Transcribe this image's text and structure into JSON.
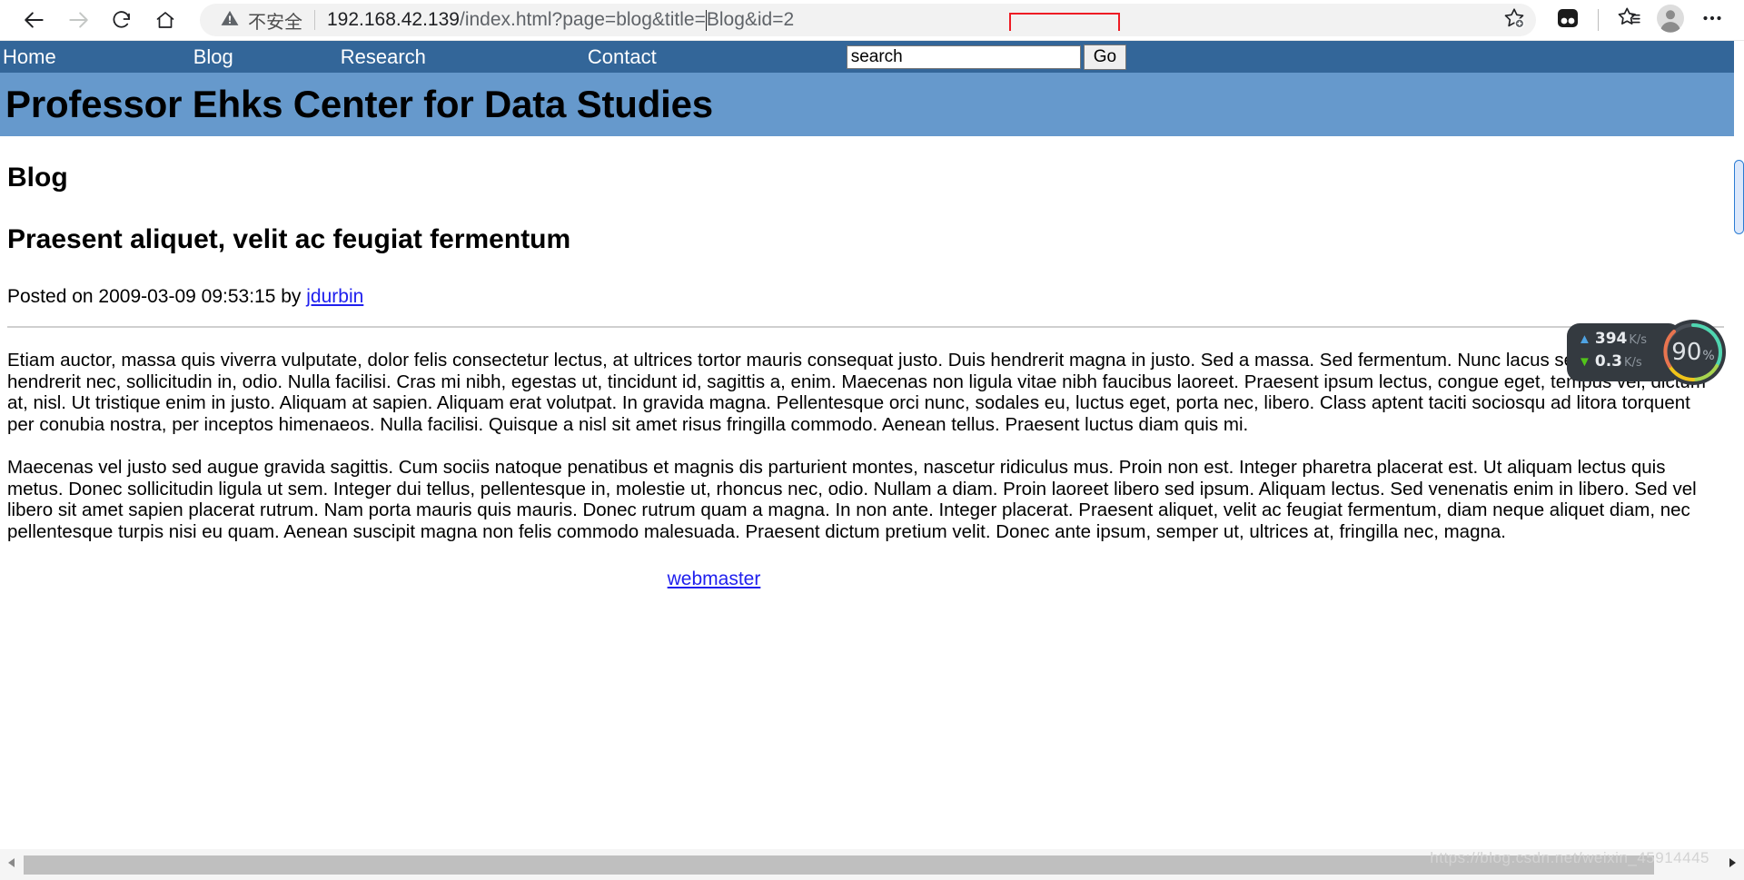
{
  "browser": {
    "back_icon": "back-arrow-icon",
    "forward_icon": "forward-arrow-icon",
    "reload_icon": "reload-icon",
    "home_icon": "home-icon",
    "security_warning_icon": "warning-triangle-icon",
    "security_label": "不安全",
    "url_host": "192.168.42.139",
    "url_path": "/index.html?page=blog&title=",
    "url_tail": "Blog&id=2",
    "url_full": "192.168.42.139/index.html?page=blog&title=Blog&id=2",
    "highlight_color": "#ee1c25",
    "bookmark_icon": "star-plus-icon",
    "collections_icon": "collections-icon",
    "favorites_icon": "favorites-star-list-icon",
    "profile_icon": "profile-avatar-icon",
    "settings_icon": "more-options-ellipsis-icon"
  },
  "site_nav": {
    "background": "#336699",
    "items": [
      {
        "label": "Home"
      },
      {
        "label": "Blog"
      },
      {
        "label": "Research"
      },
      {
        "label": "Contact"
      }
    ],
    "search_placeholder": "search",
    "search_value": "",
    "go_label": "Go"
  },
  "site_header": {
    "title": "Professor Ehks Center for Data Studies",
    "background": "#6699cc"
  },
  "page": {
    "heading": "Blog",
    "post_title": "Praesent aliquet, velit ac feugiat fermentum",
    "meta_prefix": "Posted on 2009-03-09 09:53:15 by ",
    "meta_author": "jdurbin",
    "paragraphs": [
      "Etiam auctor, massa quis viverra vulputate, dolor felis consectetur lectus, at ultrices tortor mauris consequat justo. Duis hendrerit magna in justo. Sed a massa. Sed fermentum. Nunc lacus sem, eleifend non, hendrerit nec, sollicitudin in, odio. Nulla facilisi. Cras mi nibh, egestas ut, tincidunt id, sagittis a, enim. Maecenas non ligula vitae nibh faucibus laoreet. Praesent ipsum lectus, congue eget, tempus vel, dictum at, nisl. Ut tristique enim in justo. Aliquam at sapien. Aliquam erat volutpat. In gravida magna. Pellentesque orci nunc, sodales eu, luctus eget, porta nec, libero. Class aptent taciti sociosqu ad litora torquent per conubia nostra, per inceptos himenaeos. Nulla facilisi. Quisque a nisl sit amet risus fringilla commodo. Aenean tellus. Praesent luctus diam quis mi.",
      "Maecenas vel justo sed augue gravida sagittis. Cum sociis natoque penatibus et magnis dis parturient montes, nascetur ridiculus mus. Proin non est. Integer pharetra placerat est. Ut aliquam lectus quis metus. Donec sollicitudin ligula ut sem. Integer dui tellus, pellentesque in, molestie ut, rhoncus nec, odio. Nullam a diam. Proin laoreet libero sed ipsum. Aliquam lectus. Sed venenatis enim in libero. Sed vel libero sit amet sapien placerat rutrum. Nam porta mauris quis mauris. Donec rutrum quam a magna. In non ante. Integer placerat. Praesent aliquet, velit ac feugiat fermentum, diam neque aliquet diam, nec pellentesque turpis nisi eu quam. Aenean suscipit magna non felis commodo malesuada. Praesent dictum pretium velit. Donec ante ipsum, semper ut, ultrices at, fringilla nec, magna."
    ],
    "footer_link": "webmaster",
    "link_color": "#2020ee"
  },
  "speed_widget": {
    "upload_value": "394",
    "upload_unit": "K/s",
    "upload_arrow": "arrow-up-icon",
    "download_value": "0.3",
    "download_unit": "K/s",
    "download_arrow": "arrow-down-icon",
    "gauge_value": "90",
    "gauge_unit": "%",
    "upload_color": "#4fa3e3",
    "download_color": "#52c41a",
    "panel_color": "#343a40"
  },
  "watermark": {
    "text": "https://blog.csdn.net/weixin_45914445"
  }
}
